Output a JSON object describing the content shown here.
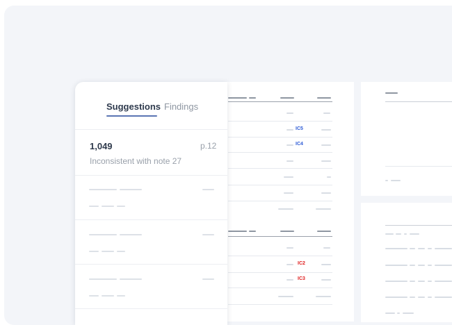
{
  "sidebar": {
    "tabs": [
      {
        "label": "Suggestions",
        "active": true
      },
      {
        "label": "Findings",
        "active": false
      }
    ],
    "first_item": {
      "value": "1,049",
      "page": "p.12",
      "description": "Inconsistent with note 27"
    }
  },
  "document": {
    "tags": [
      {
        "label": "IC5",
        "color": "#2d5bd6"
      },
      {
        "label": "IC4",
        "color": "#2d5bd6"
      },
      {
        "label": "IC2",
        "color": "#e02020"
      },
      {
        "label": "IC3",
        "color": "#e02020"
      }
    ]
  },
  "colors": {
    "accent": "#5a74b3",
    "link_blue": "#2d5bd6",
    "error_red": "#e02020",
    "background": "#f3f5f9"
  }
}
